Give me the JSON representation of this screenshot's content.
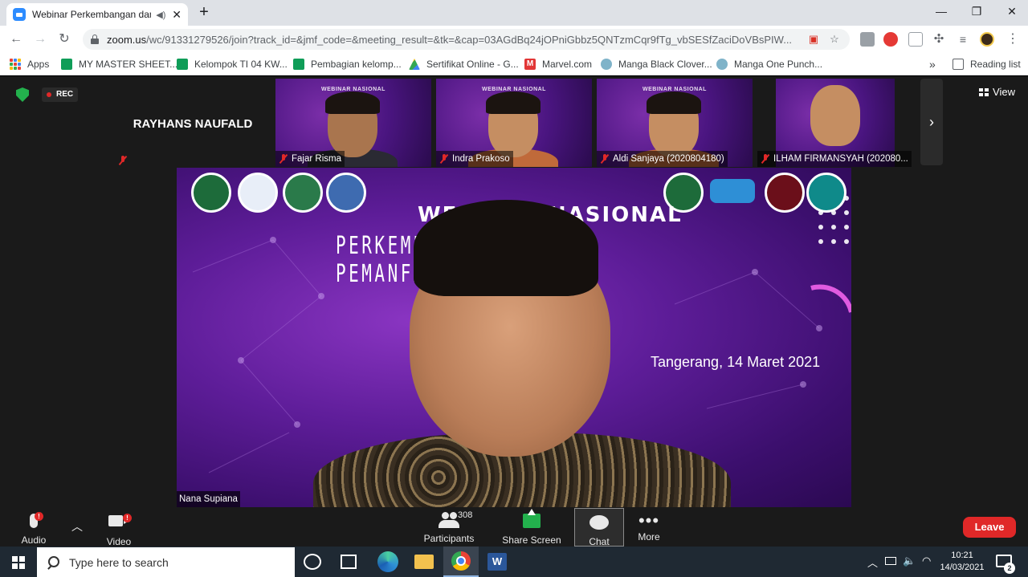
{
  "browser": {
    "tab_title": "Webinar Perkembangan dan",
    "url_host": "zoom.us",
    "url_path": "/wc/91331279526/join?track_id=&jmf_code=&meeting_result=&tk=&cap=03AGdBq24jOPniGbbz5QNTzmCqr9fTg_vbSESfZaciDoVBsPIW...",
    "bookmarks": [
      {
        "label": "Apps",
        "icon": "apps-grid-icon"
      },
      {
        "label": "MY MASTER SHEET...",
        "icon": "sheets-icon"
      },
      {
        "label": "Kelompok TI 04 KW...",
        "icon": "sheets-icon"
      },
      {
        "label": "Pembagian kelomp...",
        "icon": "sheets-icon"
      },
      {
        "label": "Sertifikat Online - G...",
        "icon": "drive-icon"
      },
      {
        "label": "Marvel.com",
        "icon": "marvel-icon"
      },
      {
        "label": "Manga Black Clover...",
        "icon": "manga-icon"
      },
      {
        "label": "Manga One Punch...",
        "icon": "manga-icon"
      }
    ],
    "reading_list": "Reading list",
    "more_bookmarks": "»"
  },
  "meeting": {
    "rec_label": "REC",
    "view_label": "View",
    "participants_strip": [
      {
        "name": "RAYHANS NAUFALD",
        "video": false,
        "muted": true
      },
      {
        "name": "Fajar Risma",
        "video": true,
        "muted": true
      },
      {
        "name": "Indra Prakoso",
        "video": true,
        "muted": true
      },
      {
        "name": "Aldi Sanjaya (2020804180)",
        "video": true,
        "muted": true
      },
      {
        "name": "ILHAM FIRMANSYAH (202080...",
        "video": true,
        "muted": true
      }
    ],
    "active_speaker": "Nana Supiana",
    "slide": {
      "title": "WEBINAR NASIONAL",
      "subtitle": "PERKEMBANGAN DAN PEMANFAATAN IOT",
      "date": "Tangerang, 14 Maret 2021"
    }
  },
  "controls": {
    "audio": {
      "label": "Audio",
      "badge": "!"
    },
    "video": {
      "label": "Video",
      "badge": "!"
    },
    "participants": {
      "label": "Participants",
      "count": "308"
    },
    "share": {
      "label": "Share Screen"
    },
    "chat": {
      "label": "Chat"
    },
    "more": {
      "label": "More"
    },
    "leave": {
      "label": "Leave"
    }
  },
  "taskbar": {
    "search_placeholder": "Type here to search",
    "time": "10:21",
    "date": "14/03/2021",
    "notifications": "2"
  },
  "colors": {
    "zoom_blue": "#2d8cff",
    "leave_red": "#e02828",
    "share_green": "#23b14d",
    "slide_purple": "#5e1d99"
  }
}
